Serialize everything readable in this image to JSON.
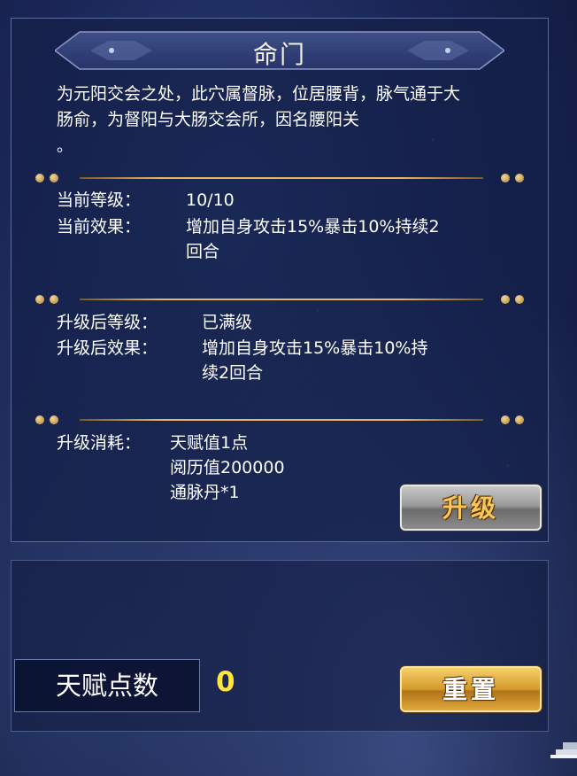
{
  "title": "命门",
  "description": "为元阳交会之处，此穴属督脉，位居腰背，脉气通于大肠俞，为督阳与大肠交会所，因名腰阳关",
  "description_tail": "。",
  "current": {
    "level_label": "当前等级：",
    "level_value": "10/10",
    "effect_label": "当前效果：",
    "effect_line1": "增加自身攻击15%暴击10%持续2",
    "effect_line2": "回合"
  },
  "next": {
    "level_label": "升级后等级：",
    "level_value": "已满级",
    "effect_label": "升级后效果：",
    "effect_line1": "增加自身攻击15%暴击10%持",
    "effect_line2": "续2回合"
  },
  "cost": {
    "label": "升级消耗：",
    "items": [
      "天赋值1点",
      "阅历值200000",
      "通脉丹*1"
    ]
  },
  "buttons": {
    "upgrade": "升级",
    "reset": "重置"
  },
  "talent_points": {
    "label": "天赋点数",
    "value": "0"
  },
  "colors": {
    "accent_gold": "#e3b765",
    "points_yellow": "#ffe53c",
    "upgrade_text": "#f7c75b"
  }
}
